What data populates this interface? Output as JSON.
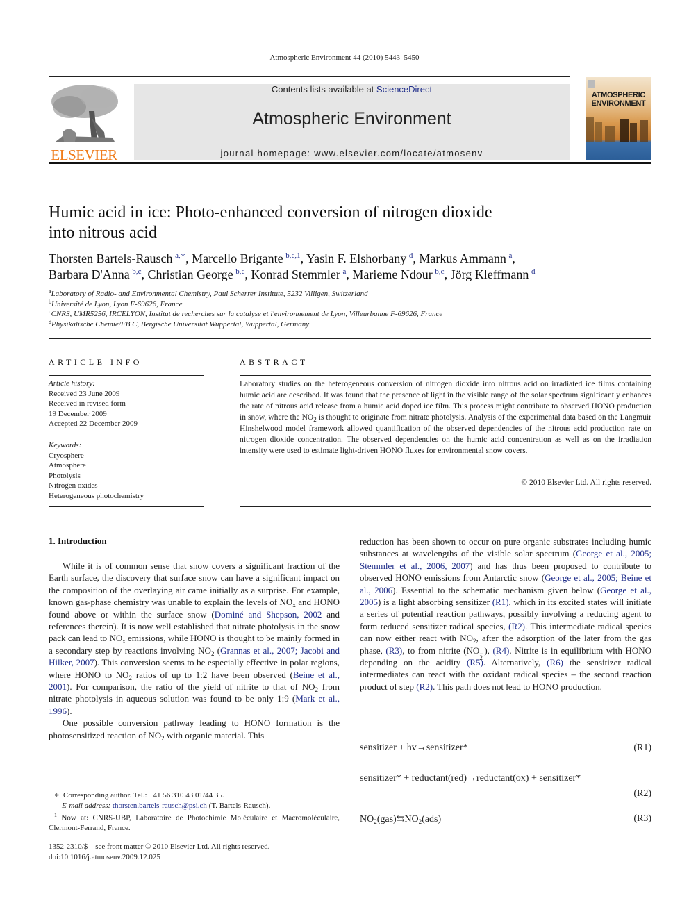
{
  "running_head": "Atmospheric Environment 44 (2010) 5443–5450",
  "masthead": {
    "publisher_logo_text": "ELSEVIER",
    "contents_prefix": "Contents lists available at ",
    "contents_link": "ScienceDirect",
    "journal_name": "Atmospheric Environment",
    "homepage": "journal homepage: www.elsevier.com/locate/atmosenv",
    "cover_title_line1": "ATMOSPHERIC",
    "cover_title_line2": "ENVIRONMENT"
  },
  "article": {
    "title_line1": "Humic acid in ice: Photo-enhanced conversion of nitrogen dioxide",
    "title_line2": "into nitrous acid",
    "authors": [
      {
        "name": "Thorsten Bartels-Rausch",
        "sup": "a,∗",
        "sep": ", "
      },
      {
        "name": "Marcello Brigante",
        "sup": "b,c,1",
        "sep": ", "
      },
      {
        "name": "Yasin F. Elshorbany",
        "sup": "d",
        "sep": ", "
      },
      {
        "name": "Markus Ammann",
        "sup": "a",
        "sep": ","
      },
      {
        "name": "Barbara D'Anna",
        "sup": "b,c",
        "sep": ", "
      },
      {
        "name": "Christian George",
        "sup": "b,c",
        "sep": ", "
      },
      {
        "name": "Konrad Stemmler",
        "sup": "a",
        "sep": ", "
      },
      {
        "name": "Marieme Ndour",
        "sup": "b,c",
        "sep": ", "
      },
      {
        "name": "Jörg Kleffmann",
        "sup": "d",
        "sep": ""
      }
    ],
    "affiliations": [
      {
        "key": "a",
        "text": "Laboratory of Radio- and Environmental Chemistry, Paul Scherrer Institute, 5232 Villigen, Switzerland"
      },
      {
        "key": "b",
        "text": "Université de Lyon, Lyon F-69626, France"
      },
      {
        "key": "c",
        "text": "CNRS, UMR5256, IRCELYON, Institut de recherches sur la catalyse et l'environnement de Lyon, Villeurbanne F-69626, France"
      },
      {
        "key": "d",
        "text": "Physikalische Chemie/FB C, Bergische Universität Wuppertal, Wuppertal, Germany"
      }
    ]
  },
  "article_info": {
    "heading": "ARTICLE INFO",
    "history_label": "Article history:",
    "history": [
      "Received 23 June 2009",
      "Received in revised form",
      "19 December 2009",
      "Accepted 22 December 2009"
    ],
    "keywords_label": "Keywords:",
    "keywords": [
      "Cryosphere",
      "Atmosphere",
      "Photolysis",
      "Nitrogen oxides",
      "Heterogeneous photochemistry"
    ]
  },
  "abstract": {
    "heading": "ABSTRACT",
    "text_part1": "Laboratory studies on the heterogeneous conversion of nitrogen dioxide into nitrous acid on irradiated ice films containing humic acid are described. It was found that the presence of light in the visible range of the solar spectrum significantly enhances the rate of nitrous acid release from a humic acid doped ice film. This process might contribute to observed HONO production in snow, where the NO",
    "text_sub": "2",
    "text_part2": " is thought to originate from nitrate photolysis. Analysis of the experimental data based on the Langmuir Hinshelwood model framework allowed quantification of the observed dependencies of the nitrous acid production rate on nitrogen dioxide concentration. The observed dependencies on the humic acid concentration as well as on the irradiation intensity were used to estimate light-driven HONO fluxes for environmental snow covers.",
    "copyright": "© 2010 Elsevier Ltd. All rights reserved."
  },
  "introduction": {
    "heading": "1.  Introduction",
    "p1": {
      "a": "While it is of common sense that snow covers a significant fraction of the Earth surface, the discovery that surface snow can have a significant impact on the composition of the overlaying air came initially as a surprise. For example, known gas-phase chemistry was unable to explain the levels of NO",
      "a_sub": "x",
      "b": " and HONO found above or within the surface snow (",
      "ref1": "Dominé and Shepson, 2002",
      "c": " and references therein). It is now well established that nitrate photolysis in the snow pack can lead to NO",
      "c_sub": "x",
      "d": " emissions, while HONO is thought to be mainly formed in a secondary step by reactions involving NO",
      "d_sub": "2",
      "e": " (",
      "ref2": "Grannas et al., 2007; Jacobi and Hilker, 2007",
      "f": "). This conversion seems to be especially effective in polar regions, where HONO to NO",
      "f_sub": "2",
      "g": " ratios of up to 1:2 have been observed (",
      "ref3": "Beine et al., 2001",
      "h": "). For comparison, the ratio of the yield of nitrite to that of NO",
      "h_sub": "2",
      "i": " from nitrate photolysis in aqueous solution was found to be only 1:9 (",
      "ref4": "Mark et al., 1996",
      "j": ")."
    },
    "p2": {
      "a": "One possible conversion pathway leading to HONO formation is the photosensitized reaction of NO",
      "a_sub": "2",
      "b": " with organic material. This reduction has been shown to occur on pure organic substrates including humic substances at wavelengths of the visible solar spectrum (",
      "ref1": "George et al., 2005; Stemmler et al., 2006, 2007",
      "c": ") and has thus been proposed to contribute to observed HONO emissions from Antarctic snow (",
      "ref2": "George et al., 2005; Beine et al., 2006",
      "d": "). Essential to the schematic mechanism given below (",
      "ref3": "George et al., 2005",
      "e": ") is a light absorbing sensitizer ",
      "ref4": "(R1)",
      "f": ", which in its excited states will initiate a series of potential reaction pathways, possibly involving a reducing agent to form reduced sensitizer radical species, ",
      "ref5": "(R2)",
      "g": ". This intermediate radical species can now either react with NO",
      "g_sub": "2",
      "h": ", after the adsorption of the later from the gas phase, ",
      "ref6": "(R3)",
      "i": ", to from nitrite (NO",
      "i_sub": "2",
      "i_sup": "−",
      "j": "), ",
      "ref7": "(R4)",
      "k": ". Nitrite is in equilibrium with HONO depending on the acidity ",
      "ref8": "(R5)",
      "l": ". Alternatively, ",
      "ref9": "(R6)",
      "m": " the sensitizer radical intermediates can react with the oxidant radical species – the second reaction product of step ",
      "ref10": "(R2)",
      "n": ". This path does not lead to HONO production."
    }
  },
  "equations": [
    {
      "text": "sensitizer + hv→sensitizer*",
      "label": "(R1)"
    },
    {
      "text": "sensitizer* + reductant(red)→reductant(ox) + sensitizer*",
      "label": "(R2)"
    },
    {
      "text_a": "NO",
      "sub_a": "2",
      "text_b": "(gas)⇆NO",
      "sub_b": "2",
      "text_c": "(ads)",
      "label": "(R3)"
    }
  ],
  "footnotes": {
    "corresponding_mark": "∗",
    "corresponding": "Corresponding author. Tel.: +41 56 310 43 01/44 35.",
    "email_label": "E-mail address: ",
    "email": "thorsten.bartels-rausch@psi.ch",
    "email_suffix": " (T. Bartels-Rausch).",
    "note1_mark": "1",
    "note1": " Now at: CNRS-UBP, Laboratoire de Photochimie Moléculaire et Macromoléculaire, Clermont-Ferrand, France."
  },
  "front_matter": {
    "issn_line": "1352-2310/$ – see front matter © 2010 Elsevier Ltd. All rights reserved.",
    "doi": "doi:10.1016/j.atmosenv.2009.12.025"
  },
  "colors": {
    "link": "#1f2d8a",
    "elsevier_orange": "#f07d1c",
    "masthead_gray": "#e6e6e6"
  }
}
